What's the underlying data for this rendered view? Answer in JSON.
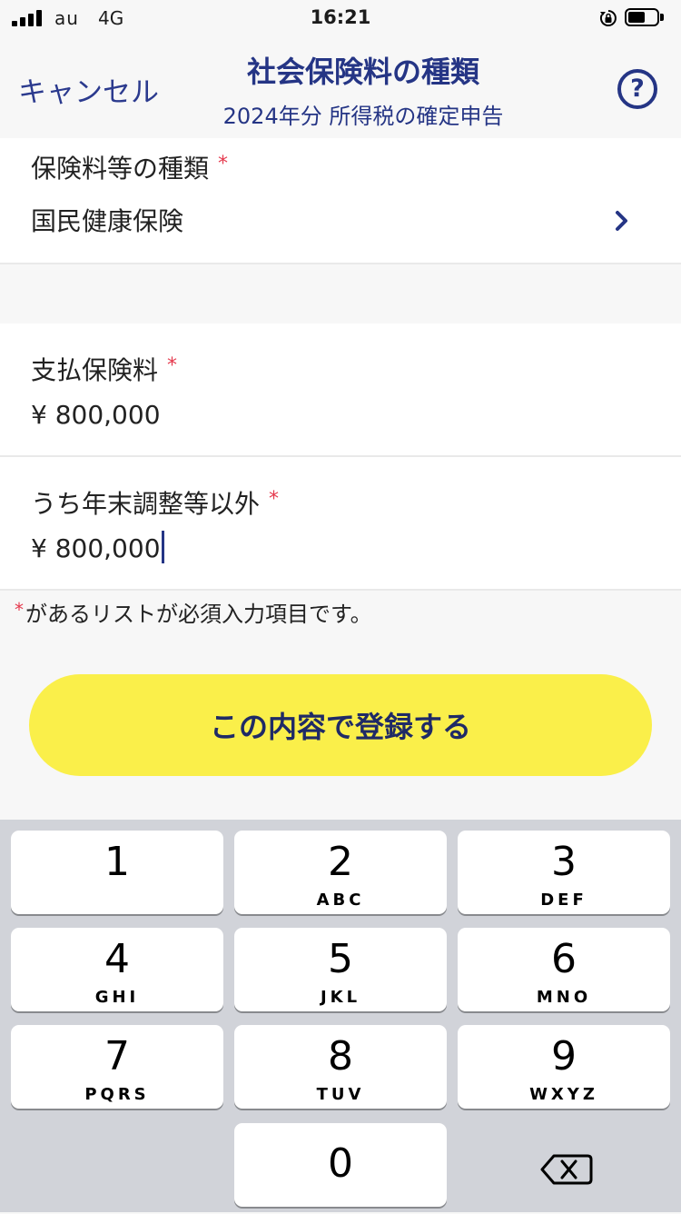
{
  "status_bar": {
    "carrier": "au",
    "network": "4G",
    "time": "16:21"
  },
  "nav": {
    "cancel_label": "キャンセル",
    "title": "社会保険料の種類",
    "subtitle": "2024年分 所得税の確定申告",
    "help_label": "?"
  },
  "form": {
    "insurance_type": {
      "label": "保険料等の種類",
      "required_mark": "*",
      "value": "国民健康保険"
    },
    "premium_paid": {
      "label": "支払保険料",
      "required_mark": "*",
      "value": "¥ 800,000"
    },
    "excluding_year_end": {
      "label": "うち年末調整等以外",
      "required_mark": "*",
      "value": "¥ 800,000"
    },
    "required_note_mark": "*",
    "required_note": "があるリストが必須入力項目です。"
  },
  "submit_label": "この内容で登録する",
  "keypad": {
    "keys": [
      {
        "digit": "1",
        "letters": ""
      },
      {
        "digit": "2",
        "letters": "ABC"
      },
      {
        "digit": "3",
        "letters": "DEF"
      },
      {
        "digit": "4",
        "letters": "GHI"
      },
      {
        "digit": "5",
        "letters": "JKL"
      },
      {
        "digit": "6",
        "letters": "MNO"
      },
      {
        "digit": "7",
        "letters": "PQRS"
      },
      {
        "digit": "8",
        "letters": "TUV"
      },
      {
        "digit": "9",
        "letters": "WXYZ"
      },
      {
        "digit": "0",
        "letters": ""
      }
    ],
    "delete_icon": "backspace-icon"
  },
  "colors": {
    "accent": "#253585",
    "required": "#e53a4e",
    "submit_bg": "#faef4a"
  }
}
